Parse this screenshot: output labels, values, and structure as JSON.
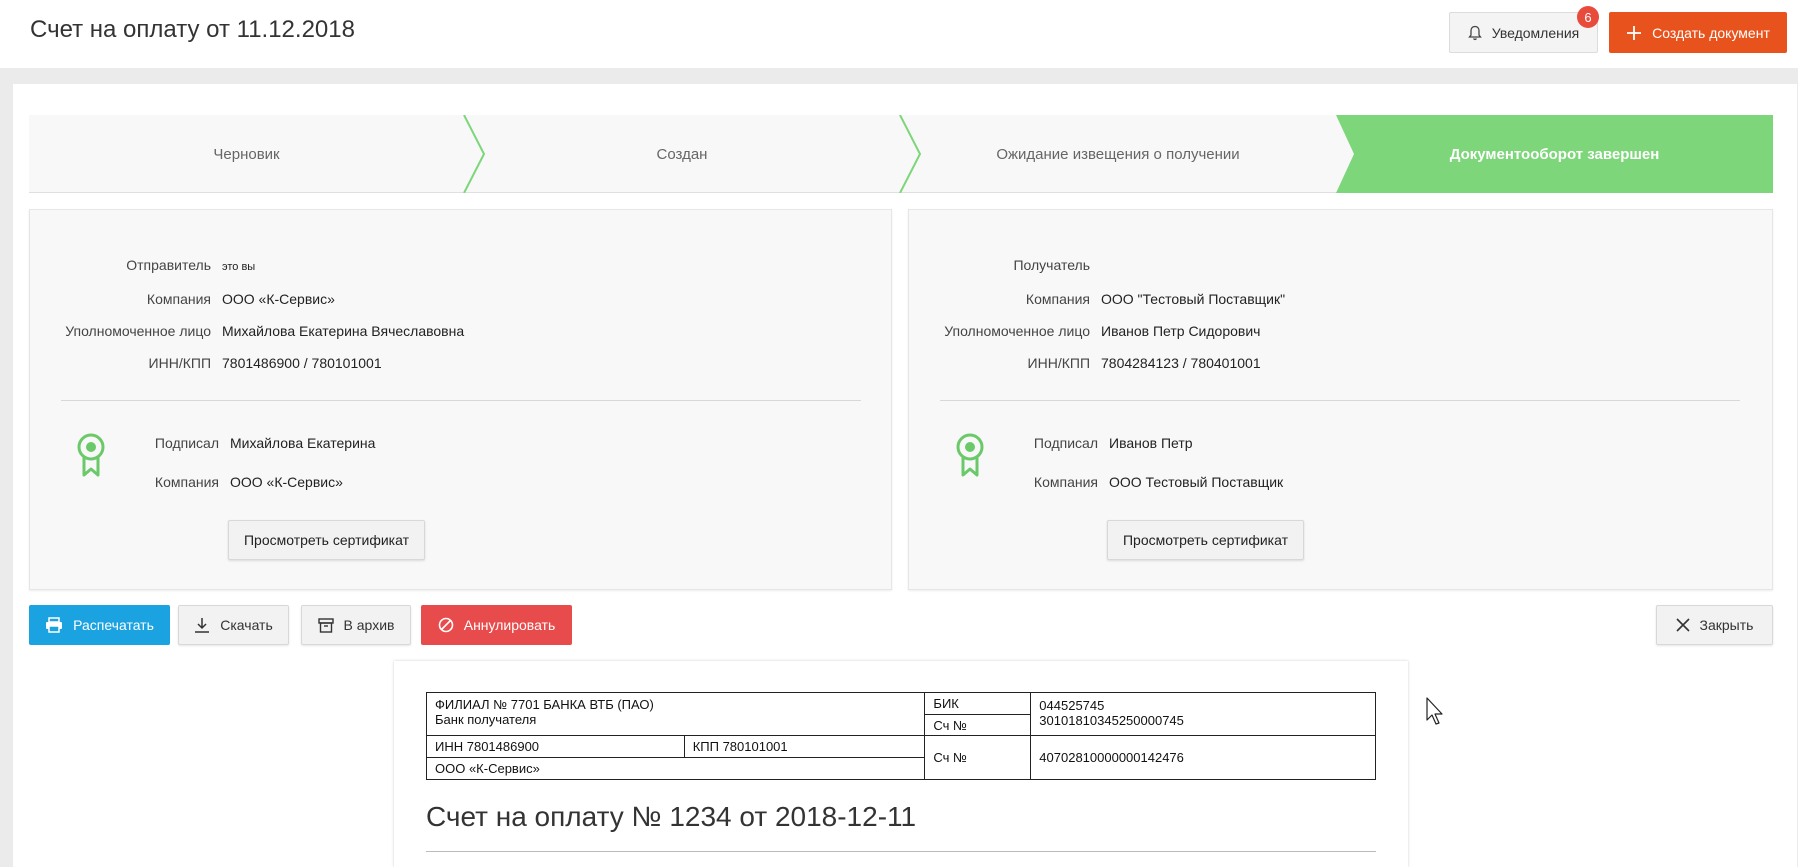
{
  "header": {
    "title": "Счет на оплату от 11.12.2018",
    "notifications_label": "Уведомления",
    "notifications_count": "6",
    "create_label": "Создать документ"
  },
  "steps": [
    {
      "label": "Черновик",
      "active": false
    },
    {
      "label": "Создан",
      "active": false
    },
    {
      "label": "Ожидание извещения о получении",
      "active": false
    },
    {
      "label": "Документооборот завершен",
      "active": true
    }
  ],
  "sender": {
    "role_label": "Отправитель",
    "role_value": "это вы",
    "company_label": "Компания",
    "company_value": "ООО «К-Сервис»",
    "person_label": "Уполномоченное лицо",
    "person_value": "Михайлова Екатерина Вячеславовна",
    "inn_label": "ИНН/КПП",
    "inn_value": "7801486900 / 780101001",
    "signed_label": "Подписал",
    "signed_value": "Михайлова Екатерина",
    "sign_company_label": "Компания",
    "sign_company_value": "ООО «К-Сервис»",
    "cert_button": "Просмотреть сертификат"
  },
  "recipient": {
    "role_label": "Получатель",
    "company_label": "Компания",
    "company_value": "ООО \"Тестовый Поставщик\"",
    "person_label": "Уполномоченное лицо",
    "person_value": "Иванов Петр Сидорович",
    "inn_label": "ИНН/КПП",
    "inn_value": "7804284123 / 780401001",
    "signed_label": "Подписал",
    "signed_value": "Иванов Петр",
    "sign_company_label": "Компания",
    "sign_company_value": "ООО Тестовый Поставщик",
    "cert_button": "Просмотреть сертификат"
  },
  "actions": {
    "print": "Распечатать",
    "download": "Скачать",
    "archive": "В архив",
    "cancel": "Аннулировать",
    "close": "Закрыть"
  },
  "document": {
    "bank_name": "ФИЛИАЛ № 7701 БАНКА ВТБ (ПАО)",
    "bank_caption": "Банк получателя",
    "bik_label": "БИК",
    "bik_value": "044525745",
    "acc_label": "Сч №",
    "corr_account": "30101810345250000745",
    "inn": "ИНН 7801486900",
    "kpp": "КПП 780101001",
    "acc_label2": "Сч №",
    "account": "40702810000000142476",
    "recipient_name": "ООО «К-Сервис»",
    "title": "Счет на оплату № 1234 от 2018-12-11"
  },
  "colors": {
    "accent_orange": "#e8531d",
    "print_blue": "#1aa3e0",
    "cancel_red": "#e84b4b",
    "step_green": "#7dd67a",
    "badge_red": "#e84b3c"
  }
}
